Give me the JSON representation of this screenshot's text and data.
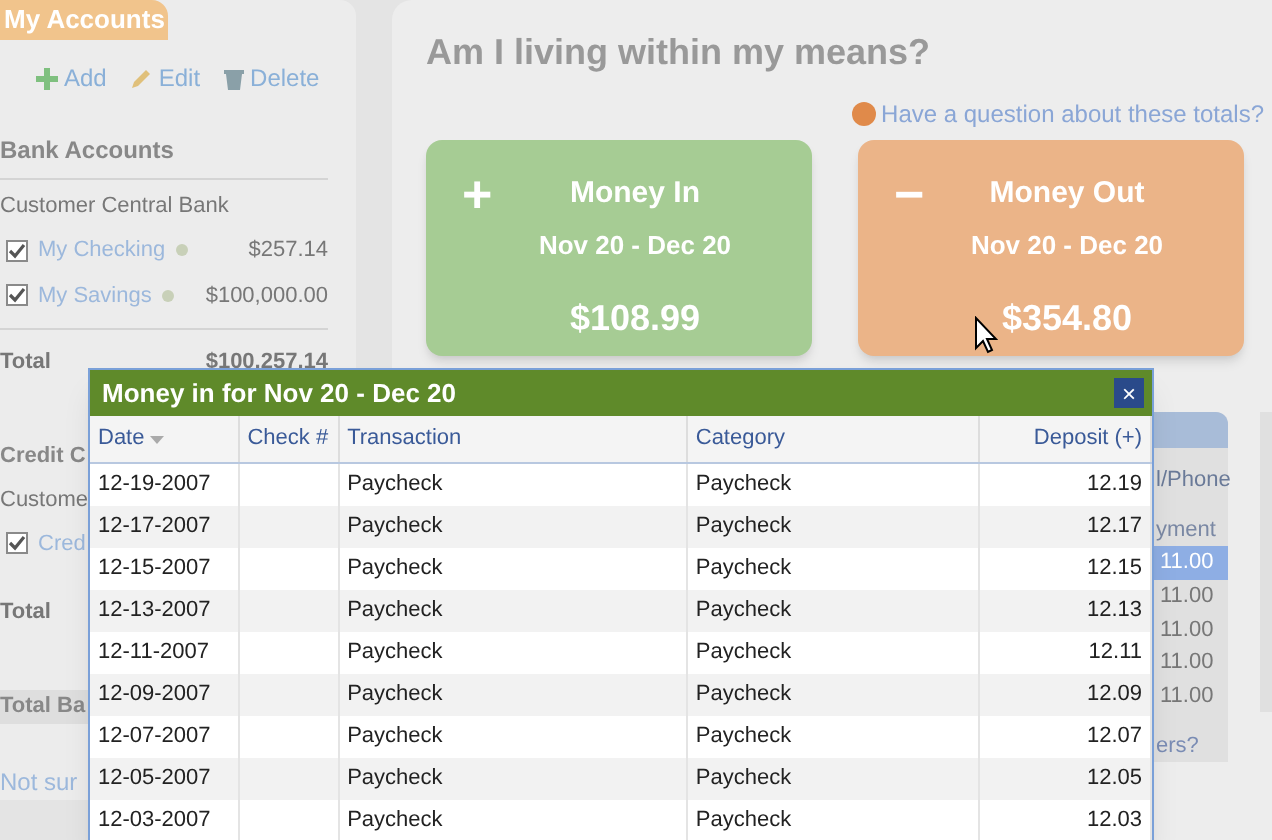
{
  "sidebar": {
    "title": "My Accounts",
    "actions": [
      "Add",
      "Edit",
      "Delete"
    ],
    "bank_section": {
      "heading": "Bank Accounts",
      "bank": "Customer Central Bank",
      "accounts": [
        {
          "name": "My Checking",
          "checked": true,
          "amount": "$257.14"
        },
        {
          "name": "My Savings",
          "checked": true,
          "amount": "$100,000.00"
        }
      ],
      "total_label": "Total",
      "total": "$100,257.14"
    },
    "credit_section": {
      "heading": "Credit C",
      "bank": "Custome",
      "accounts": [
        {
          "name": "Cred",
          "checked": true
        }
      ],
      "total_label": "Total"
    },
    "grand_total_label": "Total Ba",
    "help_link": "Not sur"
  },
  "main": {
    "title": "Am I living within my means?",
    "question_link": "Have a question about these totals?",
    "cards": [
      {
        "kind": "in",
        "sign": "+",
        "title": "Money In",
        "range": "Nov 20 - Dec 20",
        "amount": "$108.99"
      },
      {
        "kind": "out",
        "sign": "−",
        "title": "Money Out",
        "range": "Nov 20 - Dec 20",
        "amount": "$354.80"
      }
    ]
  },
  "background_table": {
    "column_1": "l/Phone",
    "column_2": "yment",
    "rows": [
      {
        "value": "11.00",
        "selected": true
      },
      {
        "value": "11.00",
        "selected": false
      },
      {
        "value": "11.00",
        "selected": false
      },
      {
        "value": "11.00",
        "selected": false
      },
      {
        "value": "11.00",
        "selected": false
      }
    ],
    "link": "ers?"
  },
  "dialog": {
    "title": "Money in for Nov 20 - Dec 20",
    "close": "×",
    "columns": [
      "Date",
      "Check #",
      "Transaction",
      "Category",
      "Deposit (+)"
    ],
    "rows": [
      [
        "12-19-2007",
        "",
        "Paycheck",
        "Paycheck",
        "12.19"
      ],
      [
        "12-17-2007",
        "",
        "Paycheck",
        "Paycheck",
        "12.17"
      ],
      [
        "12-15-2007",
        "",
        "Paycheck",
        "Paycheck",
        "12.15"
      ],
      [
        "12-13-2007",
        "",
        "Paycheck",
        "Paycheck",
        "12.13"
      ],
      [
        "12-11-2007",
        "",
        "Paycheck",
        "Paycheck",
        "12.11"
      ],
      [
        "12-09-2007",
        "",
        "Paycheck",
        "Paycheck",
        "12.09"
      ],
      [
        "12-07-2007",
        "",
        "Paycheck",
        "Paycheck",
        "12.07"
      ],
      [
        "12-05-2007",
        "",
        "Paycheck",
        "Paycheck",
        "12.05"
      ],
      [
        "12-03-2007",
        "",
        "Paycheck",
        "Paycheck",
        "12.03"
      ]
    ]
  }
}
